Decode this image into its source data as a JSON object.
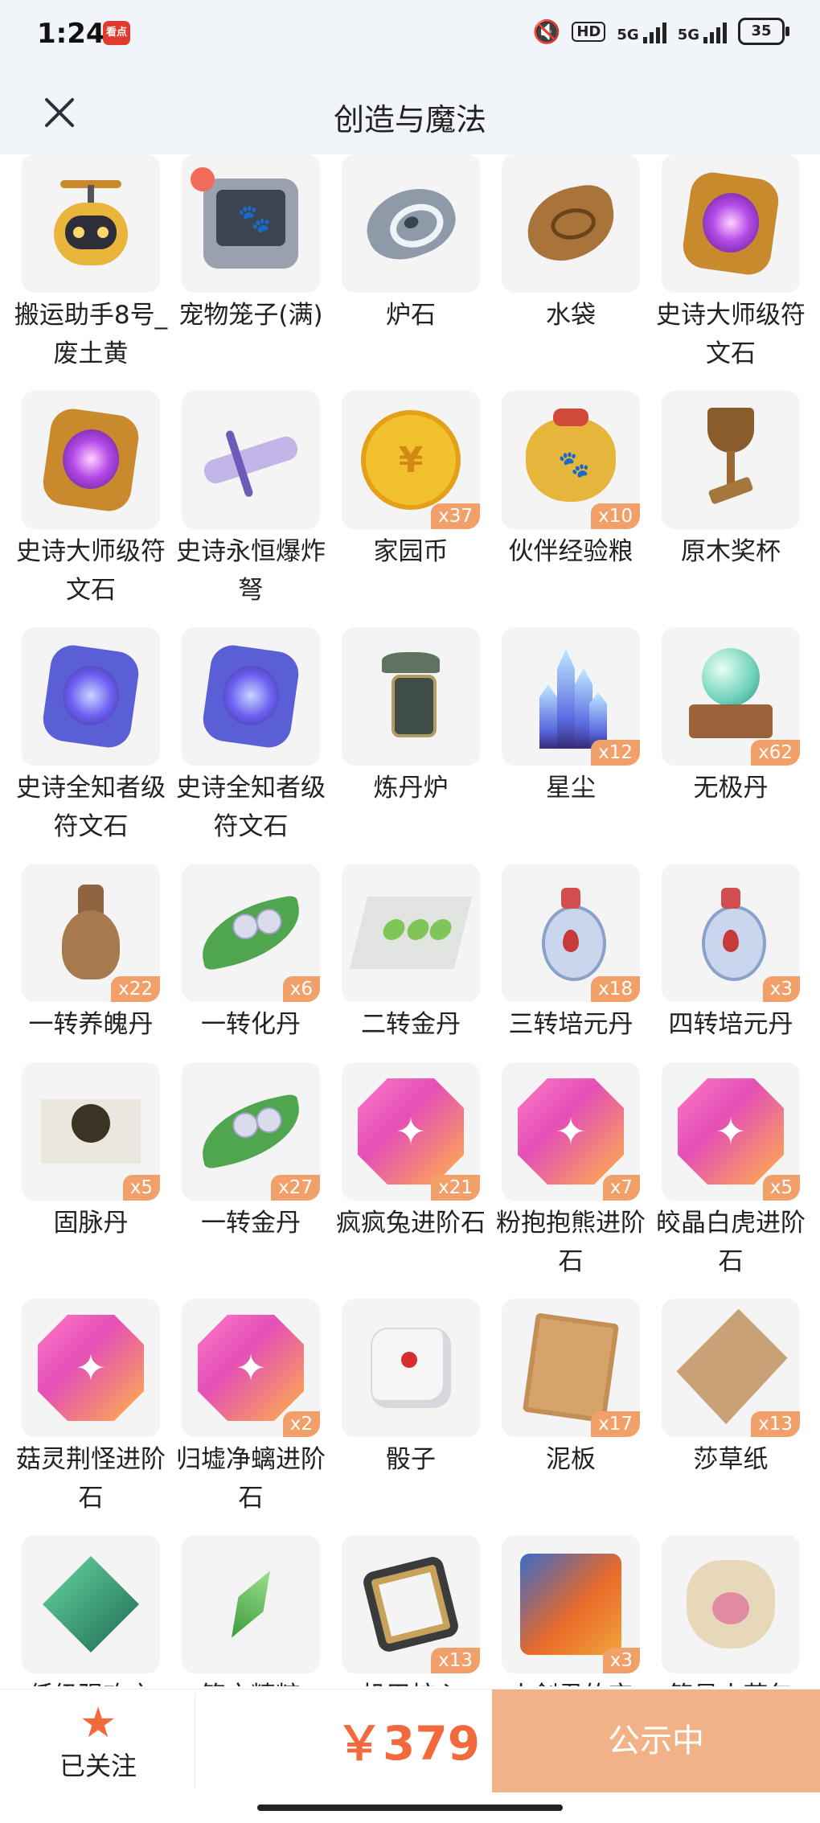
{
  "status_bar": {
    "time": "1:24",
    "app_badge": "看点",
    "hd": "HD",
    "net1": "5G",
    "net2": "5G",
    "battery": "35"
  },
  "header": {
    "title": "创造与魔法"
  },
  "grid": {
    "items": [
      {
        "name": "搬运助手8号_废土黄",
        "qty": "",
        "icon": "robot-icon"
      },
      {
        "name": "宠物笼子(满)",
        "qty": "",
        "icon": "pet-cage-icon"
      },
      {
        "name": "炉石",
        "qty": "",
        "icon": "hearthstone-icon"
      },
      {
        "name": "水袋",
        "qty": "",
        "icon": "water-pouch-icon"
      },
      {
        "name": "史诗大师级符文石",
        "qty": "",
        "icon": "rune-stone-icon"
      },
      {
        "name": "史诗大师级符文石",
        "qty": "",
        "icon": "rune-stone-icon"
      },
      {
        "name": "史诗永恒爆炸弩",
        "qty": "",
        "icon": "crossbow-icon"
      },
      {
        "name": "家园币",
        "qty": "x37",
        "icon": "coin-icon"
      },
      {
        "name": "伙伴经验粮",
        "qty": "x10",
        "icon": "food-bag-icon"
      },
      {
        "name": "原木奖杯",
        "qty": "",
        "icon": "trophy-icon"
      },
      {
        "name": "史诗全知者级符文石",
        "qty": "",
        "icon": "rune-stone-blue-icon"
      },
      {
        "name": "史诗全知者级符文石",
        "qty": "",
        "icon": "rune-stone-blue-icon"
      },
      {
        "name": "炼丹炉",
        "qty": "",
        "icon": "alchemy-furnace-icon"
      },
      {
        "name": "星尘",
        "qty": "x12",
        "icon": "crystal-icon"
      },
      {
        "name": "无极丹",
        "qty": "x62",
        "icon": "orb-icon"
      },
      {
        "name": "一转养魄丹",
        "qty": "x22",
        "icon": "vase-icon"
      },
      {
        "name": "一转化丹",
        "qty": "x6",
        "icon": "leaf-pill-icon"
      },
      {
        "name": "二转金丹",
        "qty": "",
        "icon": "cloth-pill-icon"
      },
      {
        "name": "三转培元丹",
        "qty": "x18",
        "icon": "potion-icon"
      },
      {
        "name": "四转培元丹",
        "qty": "x3",
        "icon": "potion-icon"
      },
      {
        "name": "固脉丹",
        "qty": "x5",
        "icon": "pixel-pill-icon"
      },
      {
        "name": "一转金丹",
        "qty": "x27",
        "icon": "leaf-pill-icon"
      },
      {
        "name": "疯疯兔进阶石",
        "qty": "x21",
        "icon": "gem-icon"
      },
      {
        "name": "粉抱抱熊进阶石",
        "qty": "x7",
        "icon": "gem-icon"
      },
      {
        "name": "皎晶白虎进阶石",
        "qty": "x5",
        "icon": "gem-icon"
      },
      {
        "name": "菇灵荆怪进阶石",
        "qty": "",
        "icon": "gem-icon"
      },
      {
        "name": "归墟净螭进阶石",
        "qty": "x2",
        "icon": "gem-icon"
      },
      {
        "name": "骰子",
        "qty": "",
        "icon": "dice-icon"
      },
      {
        "name": "泥板",
        "qty": "x17",
        "icon": "clay-tablet-icon"
      },
      {
        "name": "莎草纸",
        "qty": "x13",
        "icon": "papyrus-icon"
      },
      {
        "name": "低级强攻之",
        "qty": "",
        "icon": "green-diamond-icon"
      },
      {
        "name": "符文精粹",
        "qty": "",
        "icon": "green-shard-icon"
      },
      {
        "name": "机甲核心",
        "qty": "x13",
        "icon": "frame-icon"
      },
      {
        "name": "小剑君的宝",
        "qty": "x3",
        "icon": "puzzle-icon"
      },
      {
        "name": "简易小花包",
        "qty": "",
        "icon": "flower-sack-icon"
      }
    ]
  },
  "bottom_bar": {
    "follow_label": "已关注",
    "price": "￥379",
    "cta_label": "公示中"
  },
  "colors": {
    "accent": "#f26a3c",
    "badge": "#f2a06a",
    "cta_bg": "#f2b287"
  }
}
